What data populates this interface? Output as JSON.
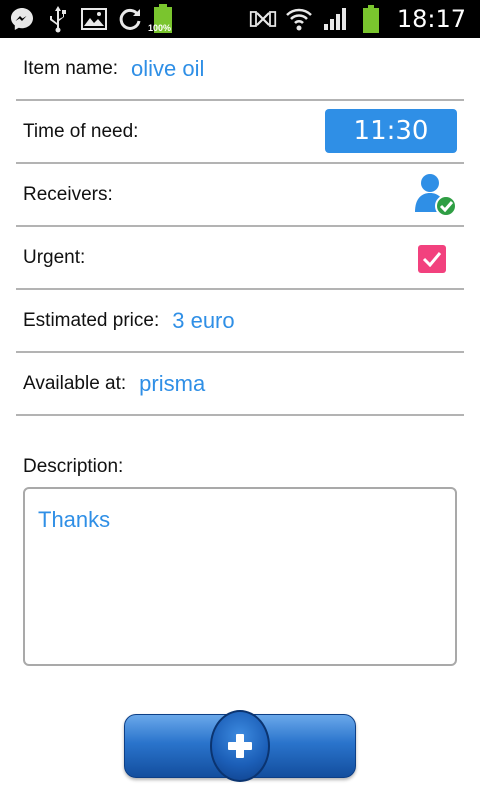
{
  "status_bar": {
    "time": "18:17",
    "battery_left_percent": "100%",
    "icons_left": [
      "messenger-icon",
      "usb-icon",
      "image-icon",
      "sync-icon",
      "battery-icon"
    ],
    "icons_right": [
      "nfc-icon",
      "wifi-icon",
      "signal-icon",
      "battery-icon"
    ]
  },
  "form": {
    "item_name": {
      "label": "Item name:",
      "value": "olive oil"
    },
    "time_of_need": {
      "label": "Time of need:",
      "value": "11:30"
    },
    "receivers": {
      "label": "Receivers:"
    },
    "urgent": {
      "label": "Urgent:",
      "checked": true
    },
    "estimated_price": {
      "label": "Estimated price:",
      "value": "3 euro"
    },
    "available_at": {
      "label": "Available at:",
      "value": "prisma"
    },
    "description": {
      "label": "Description:",
      "value": "Thanks"
    }
  },
  "colors": {
    "accent": "#2f8fe6",
    "checkbox": "#f2417e",
    "battery": "#7ac52e",
    "receiver_check": "#2f9e44"
  }
}
